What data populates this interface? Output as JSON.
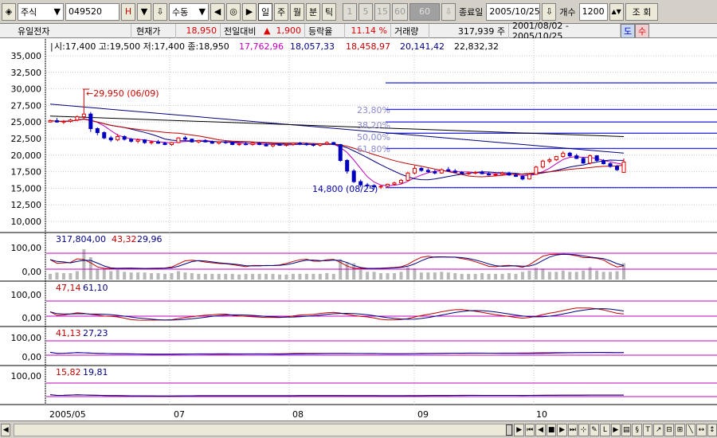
{
  "toolbar": {
    "market": "주식",
    "code": "049520",
    "h_btn": "H",
    "adjust": "수동",
    "periods": [
      "일",
      "주",
      "월",
      "분",
      "틱"
    ],
    "intervals": [
      "1",
      "5",
      "15",
      "60",
      "60"
    ],
    "end_date_label": "종료일",
    "end_date": "2005/10/25",
    "count_label": "개수",
    "count": "1200",
    "query_btn": "조 회"
  },
  "info": {
    "name": "유일전자",
    "price_label": "현재가",
    "price": "18,950",
    "change_label": "전일대비",
    "change_arrow": "▲",
    "change": "1,900",
    "rate_label": "등락율",
    "rate": "11.14 %",
    "volume_label": "거래량",
    "volume": "317,939 주",
    "range": "2001/08/02 - 2005/10/25",
    "btn_do": "도",
    "btn_su": "수"
  },
  "chart_data": {
    "type": "candlestick",
    "price_pane": {
      "header_ohlc": "시:17,400 고:19,500 저:17,400 종:18,950",
      "ma_values": [
        "17,762,96",
        "18,057,33",
        "18,458,97",
        "20,141,42",
        "22,832,32"
      ],
      "y_ticks": [
        "35,000",
        "32,500",
        "30,000",
        "27,500",
        "25,000",
        "22,500",
        "20,000",
        "17,500",
        "15,000",
        "12,500",
        "10,000"
      ],
      "ylim": [
        10000,
        35000
      ],
      "high_annotation": "←29,950 (06/09)",
      "low_annotation": "14,800 (08/25)",
      "fib_levels": [
        {
          "label": "23,80%",
          "value": 26900
        },
        {
          "label": "38,20%",
          "value": 25000
        },
        {
          "label": "50,00%",
          "value": 23300
        },
        {
          "label": "61,80%",
          "value": 21000
        }
      ],
      "h_lines": [
        30900,
        26900,
        25000,
        23300,
        21000,
        15100
      ]
    },
    "volume_pane": {
      "values_text": [
        "317,804,00",
        "43,32",
        "29,96"
      ],
      "y_ticks": [
        "100,00",
        "0,00"
      ]
    },
    "pane3": {
      "values_text": [
        "47,14",
        "61,10"
      ],
      "y_ticks": [
        "100,00",
        "0,00"
      ]
    },
    "pane4": {
      "values_text": [
        "41,13",
        "27,23"
      ],
      "y_ticks": [
        "100,00",
        "0,00"
      ]
    },
    "pane5": {
      "values_text": [
        "15,82",
        "19,81"
      ],
      "y_ticks": [
        "100,00"
      ]
    },
    "x_ticks": [
      "2005/05",
      "07",
      "08",
      "09",
      "10"
    ],
    "candles": [
      [
        25000,
        25400,
        24900,
        25200
      ],
      [
        25200,
        25600,
        24900,
        25000
      ],
      [
        25000,
        25300,
        24700,
        25100
      ],
      [
        25100,
        25500,
        24900,
        25300
      ],
      [
        25300,
        26000,
        25100,
        25800
      ],
      [
        25800,
        29950,
        25500,
        26200
      ],
      [
        26200,
        26500,
        23500,
        24000
      ],
      [
        24000,
        24200,
        23000,
        23400
      ],
      [
        23400,
        23600,
        22400,
        22600
      ],
      [
        22600,
        22900,
        22000,
        22300
      ],
      [
        22300,
        23200,
        22100,
        22800
      ],
      [
        22800,
        23000,
        22200,
        22400
      ],
      [
        22400,
        22600,
        21900,
        22100
      ],
      [
        22100,
        22500,
        21800,
        22300
      ],
      [
        22300,
        22400,
        21700,
        21900
      ],
      [
        21900,
        22200,
        21600,
        22000
      ],
      [
        22000,
        22300,
        21700,
        21800
      ],
      [
        21800,
        22000,
        21500,
        21600
      ],
      [
        21600,
        22000,
        21400,
        21900
      ],
      [
        21900,
        22700,
        21800,
        22600
      ],
      [
        22600,
        22900,
        22200,
        22400
      ],
      [
        22400,
        22500,
        21900,
        22000
      ],
      [
        22000,
        22300,
        21800,
        22200
      ],
      [
        22200,
        22400,
        21900,
        22000
      ],
      [
        22000,
        22200,
        21700,
        21800
      ],
      [
        21800,
        22100,
        21600,
        22000
      ],
      [
        22000,
        22200,
        21700,
        21900
      ],
      [
        21900,
        22000,
        21500,
        21600
      ],
      [
        21600,
        21800,
        21400,
        21700
      ],
      [
        21700,
        22000,
        21500,
        21600
      ],
      [
        21600,
        21900,
        21400,
        21800
      ],
      [
        21800,
        22000,
        21500,
        21600
      ],
      [
        21600,
        21800,
        21300,
        21400
      ],
      [
        21400,
        21700,
        21200,
        21600
      ],
      [
        21600,
        21800,
        21400,
        21500
      ],
      [
        21500,
        21700,
        21300,
        21600
      ],
      [
        21600,
        21900,
        21400,
        21800
      ],
      [
        21800,
        22000,
        21500,
        21700
      ],
      [
        21700,
        21900,
        21400,
        21600
      ],
      [
        21600,
        21800,
        21300,
        21500
      ],
      [
        21500,
        21800,
        21300,
        21700
      ],
      [
        21700,
        22100,
        21500,
        21900
      ],
      [
        21900,
        22000,
        21500,
        21600
      ],
      [
        21600,
        21700,
        19000,
        19200
      ],
      [
        19200,
        19400,
        17200,
        17600
      ],
      [
        17600,
        17900,
        15800,
        16000
      ],
      [
        16000,
        16300,
        15200,
        15500
      ],
      [
        15500,
        15800,
        15000,
        15400
      ],
      [
        15400,
        15600,
        14800,
        15200
      ],
      [
        15200,
        15500,
        14900,
        15300
      ],
      [
        15300,
        15700,
        15100,
        15600
      ],
      [
        15600,
        16000,
        15400,
        15800
      ],
      [
        15800,
        16400,
        15600,
        16200
      ],
      [
        16200,
        17500,
        16000,
        17300
      ],
      [
        17300,
        18400,
        17100,
        18000
      ],
      [
        18000,
        18200,
        17500,
        17700
      ],
      [
        17700,
        18000,
        17300,
        17500
      ],
      [
        17500,
        17800,
        17100,
        17300
      ],
      [
        17300,
        18000,
        17200,
        17800
      ],
      [
        17800,
        18200,
        17500,
        17600
      ],
      [
        17600,
        17900,
        17300,
        17400
      ],
      [
        17400,
        17600,
        17100,
        17200
      ],
      [
        17200,
        17500,
        17000,
        17300
      ],
      [
        17300,
        17600,
        17100,
        17400
      ],
      [
        17400,
        17700,
        17100,
        17200
      ],
      [
        17200,
        17400,
        16900,
        17000
      ],
      [
        17000,
        17300,
        16800,
        17100
      ],
      [
        17100,
        17500,
        17000,
        17300
      ],
      [
        17300,
        17500,
        16900,
        17000
      ],
      [
        17000,
        17200,
        16700,
        16800
      ],
      [
        16800,
        17000,
        16200,
        16400
      ],
      [
        16400,
        17300,
        16300,
        17100
      ],
      [
        17100,
        18400,
        17000,
        18200
      ],
      [
        18200,
        19300,
        18000,
        19100
      ],
      [
        19100,
        19600,
        18800,
        19300
      ],
      [
        19300,
        19900,
        19100,
        19800
      ],
      [
        19800,
        20600,
        19600,
        20300
      ],
      [
        20300,
        20500,
        19700,
        19900
      ],
      [
        19900,
        20200,
        19400,
        19500
      ],
      [
        19500,
        19700,
        18700,
        18800
      ],
      [
        18800,
        20100,
        18600,
        19900
      ],
      [
        19900,
        20000,
        19000,
        19200
      ],
      [
        19200,
        19400,
        18600,
        18700
      ],
      [
        18700,
        18900,
        18100,
        18300
      ],
      [
        18300,
        18500,
        17600,
        17800
      ],
      [
        17400,
        19500,
        17400,
        18950
      ]
    ]
  }
}
